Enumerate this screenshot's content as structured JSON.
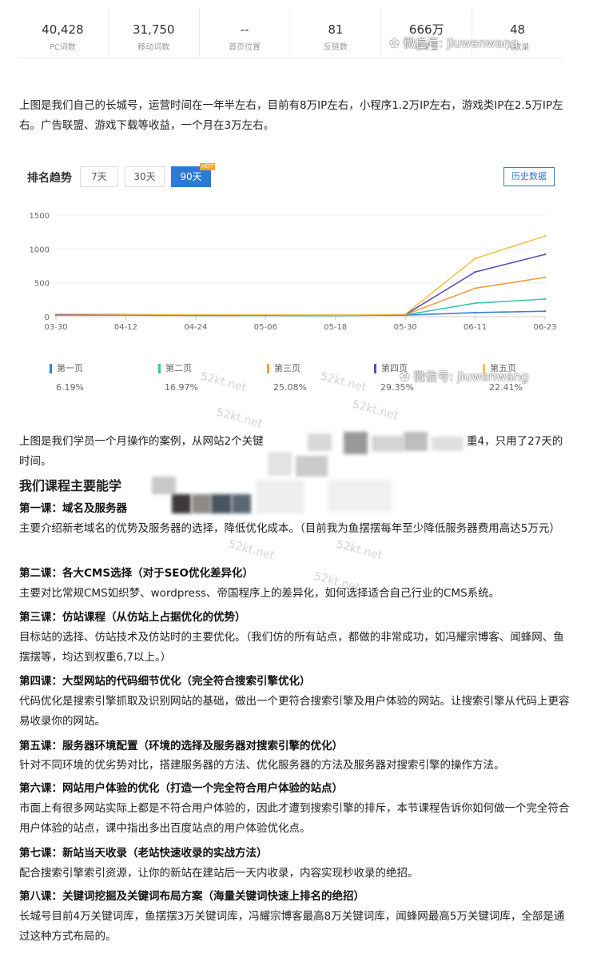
{
  "stats": [
    {
      "value": "40,428",
      "label": "PC词数"
    },
    {
      "value": "31,750",
      "label": "移动词数"
    },
    {
      "value": "--",
      "label": "首页位置"
    },
    {
      "value": "81",
      "label": "反链数"
    },
    {
      "value": "666万",
      "label": "收录量"
    },
    {
      "value": "48",
      "label": "入收录"
    }
  ],
  "watermark": "微信号: jiuwenwang",
  "site_watermark": "52kt.net",
  "intro": "上图是我们自己的长城号，运营时间在一年半左右，目前有8万IP左右，小程序1.2万IP左右，游戏类IP在2.5万IP左右。广告联盟、游戏下载等收益，一个月在3万左右。",
  "chart_header": {
    "title": "排名趋势",
    "tabs": [
      "7天",
      "30天",
      "90天"
    ],
    "hot": "HOT",
    "history": "历史数据"
  },
  "chart_data": {
    "type": "line",
    "x": [
      "03-30",
      "04-12",
      "04-24",
      "05-06",
      "05-18",
      "05-30",
      "06-11",
      "06-23"
    ],
    "ylim": [
      0,
      1500
    ],
    "yticks": [
      0,
      500,
      1000,
      1500
    ],
    "series": [
      {
        "name": "第一页",
        "color": "#3a7fd5",
        "pct": "6.19%",
        "values": [
          25,
          25,
          20,
          20,
          18,
          22,
          60,
          80
        ]
      },
      {
        "name": "第二页",
        "color": "#3cc7a7",
        "pct": "16.97%",
        "values": [
          25,
          25,
          20,
          20,
          18,
          25,
          200,
          260
        ]
      },
      {
        "name": "第三页",
        "color": "#f0a040",
        "pct": "25.08%",
        "values": [
          35,
          30,
          28,
          25,
          22,
          30,
          420,
          580
        ]
      },
      {
        "name": "第四页",
        "color": "#5a4fb5",
        "pct": "29.35%",
        "values": [
          30,
          30,
          25,
          22,
          22,
          30,
          660,
          920
        ]
      },
      {
        "name": "第五页",
        "color": "#f3c24f",
        "pct": "22.41%",
        "values": [
          40,
          35,
          30,
          28,
          25,
          35,
          860,
          1190
        ]
      }
    ]
  },
  "case_text_a": "上图是我们学员一个月操作的案例，从网站2个关键",
  "case_text_b": "重4，只用了27天的",
  "case_text_c": "时间。",
  "h2": "我们课程主要能学",
  "lessons": [
    {
      "title": "第一课：域名及服务器",
      "desc": "主要介绍新老域名的优势及服务器的选择，降低优化成本。（目前我为鱼摆摆每年至少降低服务器费用高达5万元）"
    },
    {
      "title": "第二课：各大CMS选择（对于SEO优化差异化）",
      "desc": "主要对比常规CMS如织梦、wordpress、帝国程序上的差异化，如何选择适合自己行业的CMS系统。"
    },
    {
      "title": "第三课：仿站课程（从仿站上占据优化的优势）",
      "desc": "目标站的选择、仿站技术及仿站时的主要优化。（我们仿的所有站点，都做的非常成功，如冯耀宗博客、闻蜂网、鱼摆摆等，均达到权重6,7以上。）"
    },
    {
      "title": "第四课：大型网站的代码细节优化（完全符合搜索引擎优化）",
      "desc": "代码优化是搜索引擎抓取及识别网站的基础，做出一个更符合搜索引擎及用户体验的网站。让搜索引擎从代码上更容易收录你的网站。"
    },
    {
      "title": "第五课：服务器环境配置（环境的选择及服务器对搜索引擎的优化）",
      "desc": "针对不同环境的优劣势对比，搭建服务器的方法、优化服务器的方法及服务器对搜索引擎的操作方法。"
    },
    {
      "title": "第六课：网站用户体验的优化（打造一个完全符合用户体验的站点）",
      "desc": "市面上有很多网站实际上都是不符合用户体验的，因此才遭到搜索引擎的排斥，本节课程告诉你如何做一个完全符合用户体验的站点，课中指出多出百度站点的用户体验优化点。"
    },
    {
      "title": "第七课：新站当天收录（老站快速收录的实战方法）",
      "desc": "配合搜索引擎索引资源，让你的新站在建站后一天内收录，内容实现秒收录的绝招。"
    },
    {
      "title": "第八课：关键词挖掘及关键词布局方案（海量关键词快速上排名的绝招）",
      "desc": "长城号目前4万关键词库，鱼摆摆3万关键词库，冯耀宗博客最高8万关键词库，闻蜂网最高5万关键词库，全部是通过这种方式布局的。"
    }
  ]
}
